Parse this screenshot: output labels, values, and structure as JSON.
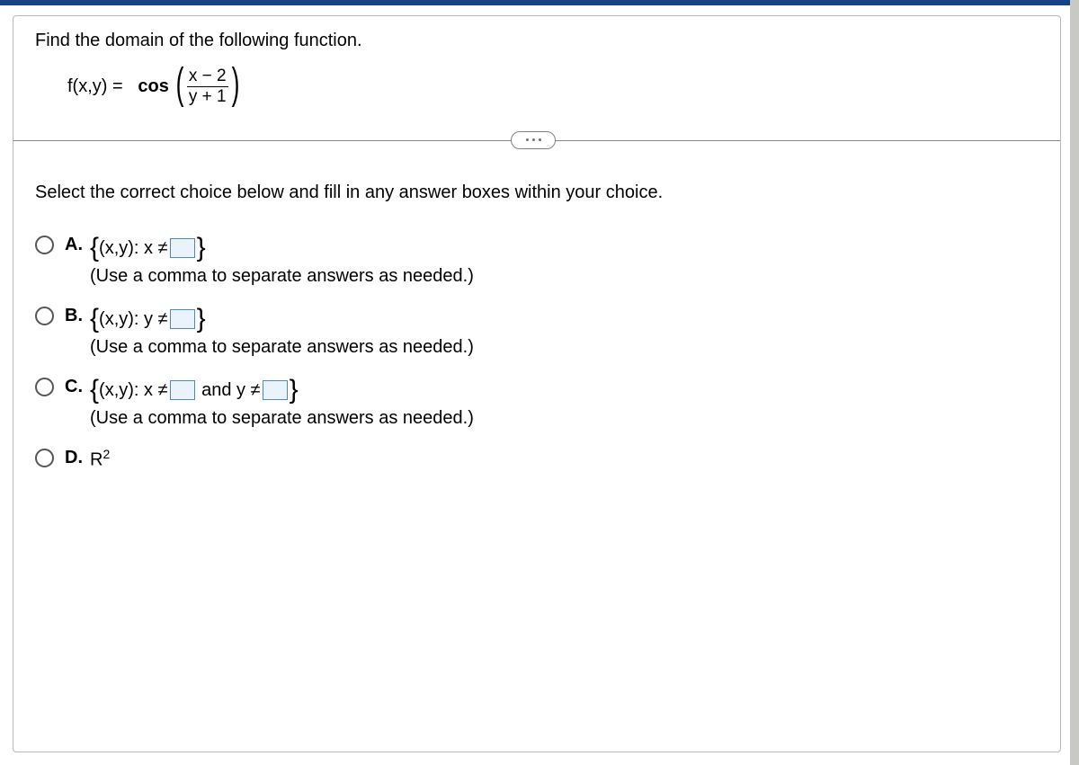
{
  "question": "Find the domain of the following function.",
  "equation": {
    "lhs": "f(x,y) =",
    "func": "cos",
    "numerator": "x − 2",
    "denominator": "y + 1"
  },
  "instruction": "Select the correct choice below and fill in any answer boxes within your choice.",
  "hint_text": "(Use a comma to separate answers as needed.)",
  "choices": {
    "a": {
      "letter": "A.",
      "pre": "(x,y): x ≠"
    },
    "b": {
      "letter": "B.",
      "pre": "(x,y): y ≠"
    },
    "c": {
      "letter": "C.",
      "pre": "(x,y): x ≠",
      "mid": "and y ≠"
    },
    "d": {
      "letter": "D.",
      "text_base": "R",
      "text_sup": "2"
    }
  }
}
